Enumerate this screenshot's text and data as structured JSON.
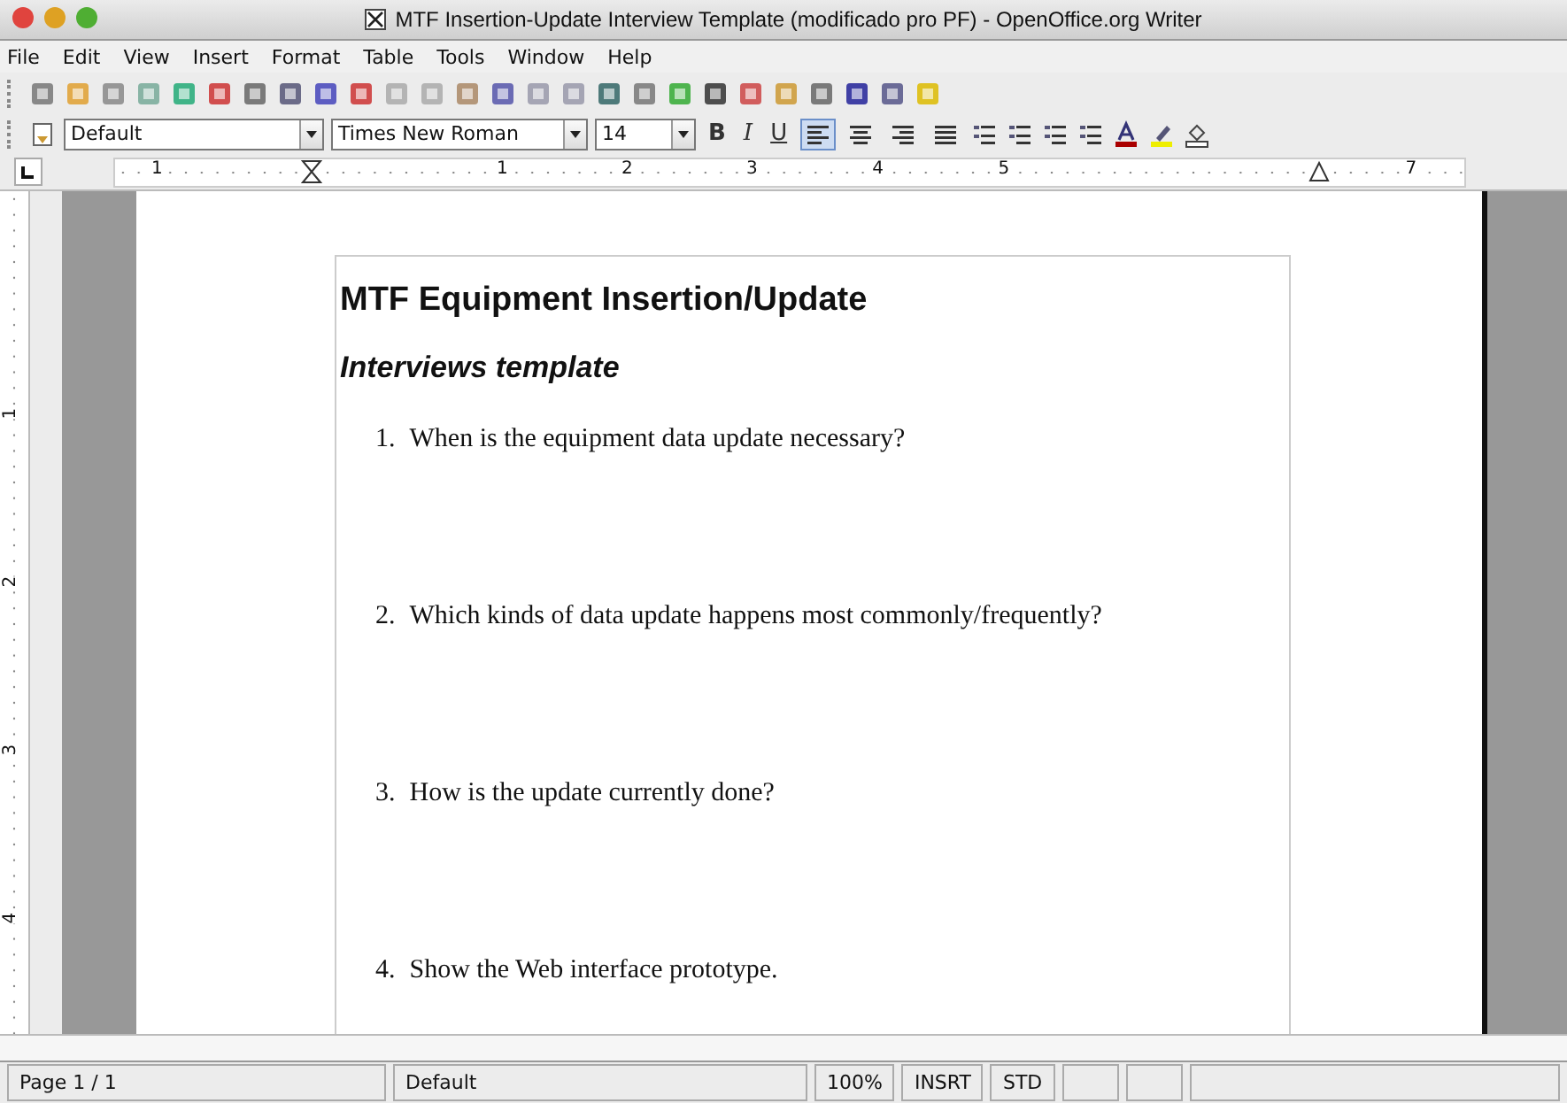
{
  "window": {
    "title": "MTF Insertion-Update Interview Template (modificado pro PF) - OpenOffice.org Writer"
  },
  "menu": [
    "File",
    "Edit",
    "View",
    "Insert",
    "Format",
    "Table",
    "Tools",
    "Window",
    "Help"
  ],
  "formatting": {
    "style": "Default",
    "font": "Times New Roman",
    "size": "14",
    "bold": "B",
    "italic": "I",
    "underline": "U",
    "align": [
      {
        "selected": true
      },
      {
        "selected": false
      },
      {
        "selected": false
      },
      {
        "selected": false
      }
    ]
  },
  "ruler": {
    "labels": [
      "1",
      "1",
      "2",
      "3",
      "4",
      "5",
      "7"
    ],
    "vertical_labels": [
      "1",
      "2",
      "3",
      "4"
    ]
  },
  "document": {
    "heading": "MTF Equipment Insertion/Update",
    "subheading": "Interviews template",
    "items": [
      {
        "number": "1.",
        "text": "When is the equipment data update necessary?"
      },
      {
        "number": "2.",
        "text": "Which kinds of data update happens most commonly/frequently?"
      },
      {
        "number": "3.",
        "text": "How is the update currently done?"
      },
      {
        "number": "4.",
        "text": "Show the Web interface prototype."
      }
    ]
  },
  "status_bar": {
    "page": "Page 1 / 1",
    "style": "Default",
    "zoom": "100%",
    "insert_mode": "INSRT",
    "selection_mode": "STD"
  }
}
